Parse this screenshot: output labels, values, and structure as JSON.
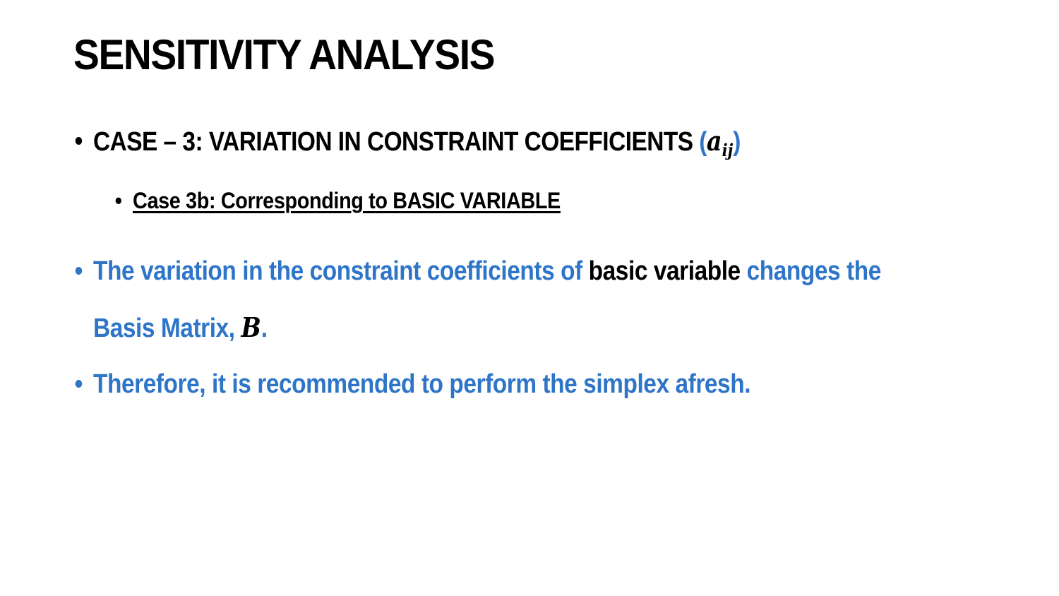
{
  "title": "SENSITIVITY ANALYSIS",
  "bullet_char": "•",
  "case": {
    "label": "CASE – 3: VARIATION IN CONSTRAINT COEFFICIENTS ",
    "paren_open": "(",
    "math_symbol": "a",
    "math_subscript": "ij",
    "paren_close": ")"
  },
  "subcase": {
    "label": "Case 3b: Corresponding to BASIC VARIABLE"
  },
  "point1": {
    "part1": "The variation in the constraint coefficients of ",
    "highlight": "basic variable",
    "part2": " changes the",
    "line2_text": "Basis Matrix, ",
    "math_symbol": "B",
    "end": "."
  },
  "point2": {
    "text": "Therefore, it is recommended to perform the simplex afresh."
  },
  "colors": {
    "accent": "#2e75c8",
    "text": "#000000",
    "background": "#ffffff"
  }
}
